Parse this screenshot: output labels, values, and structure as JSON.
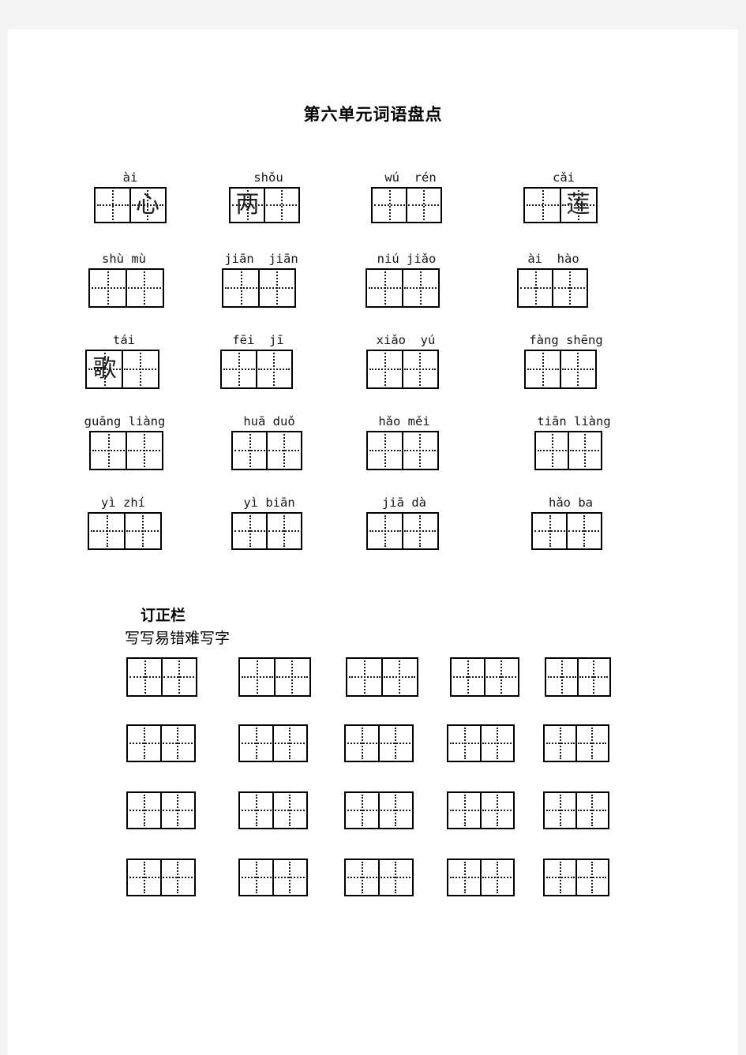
{
  "document": {
    "title": "第六单元词语盘点",
    "background_color": "#f4f4f4",
    "paper_color": "#ffffff"
  },
  "word_section": {
    "rows": [
      {
        "cells": [
          {
            "pinyin": "ài",
            "left_char": "",
            "right_char": "心"
          },
          {
            "pinyin": "shǒu",
            "left_char": "两",
            "right_char": ""
          },
          {
            "pinyin": "wú  rén",
            "left_char": "",
            "right_char": ""
          },
          {
            "pinyin": "cǎi",
            "left_char": "",
            "right_char": "莲"
          }
        ]
      },
      {
        "cells": [
          {
            "pinyin": "shù mù",
            "left_char": "",
            "right_char": ""
          },
          {
            "pinyin": "jiān  jiān",
            "left_char": "",
            "right_char": ""
          },
          {
            "pinyin": "niú jiǎo",
            "left_char": "",
            "right_char": ""
          },
          {
            "pinyin": "ài  hào",
            "left_char": "",
            "right_char": ""
          }
        ]
      },
      {
        "cells": [
          {
            "pinyin": "tái",
            "left_char": "歌",
            "right_char": ""
          },
          {
            "pinyin": "fēi  jī",
            "left_char": "",
            "right_char": ""
          },
          {
            "pinyin": "xiǎo  yú",
            "left_char": "",
            "right_char": ""
          },
          {
            "pinyin": "fàng shēng",
            "left_char": "",
            "right_char": ""
          }
        ]
      },
      {
        "cells": [
          {
            "pinyin": "guāng liàng",
            "left_char": "",
            "right_char": ""
          },
          {
            "pinyin": "huā duǒ",
            "left_char": "",
            "right_char": ""
          },
          {
            "pinyin": "hǎo měi",
            "left_char": "",
            "right_char": ""
          },
          {
            "pinyin": "tiān liàng",
            "left_char": "",
            "right_char": ""
          }
        ]
      },
      {
        "cells": [
          {
            "pinyin": "yì zhí",
            "left_char": "",
            "right_char": ""
          },
          {
            "pinyin": "yì biān",
            "left_char": "",
            "right_char": ""
          },
          {
            "pinyin": "jiā dà",
            "left_char": "",
            "right_char": ""
          },
          {
            "pinyin": "hǎo ba",
            "left_char": "",
            "right_char": ""
          }
        ]
      }
    ]
  },
  "correction_section": {
    "heading": "订正栏",
    "subheading": "写写易错难写字",
    "rows": 4,
    "cols": 5
  }
}
